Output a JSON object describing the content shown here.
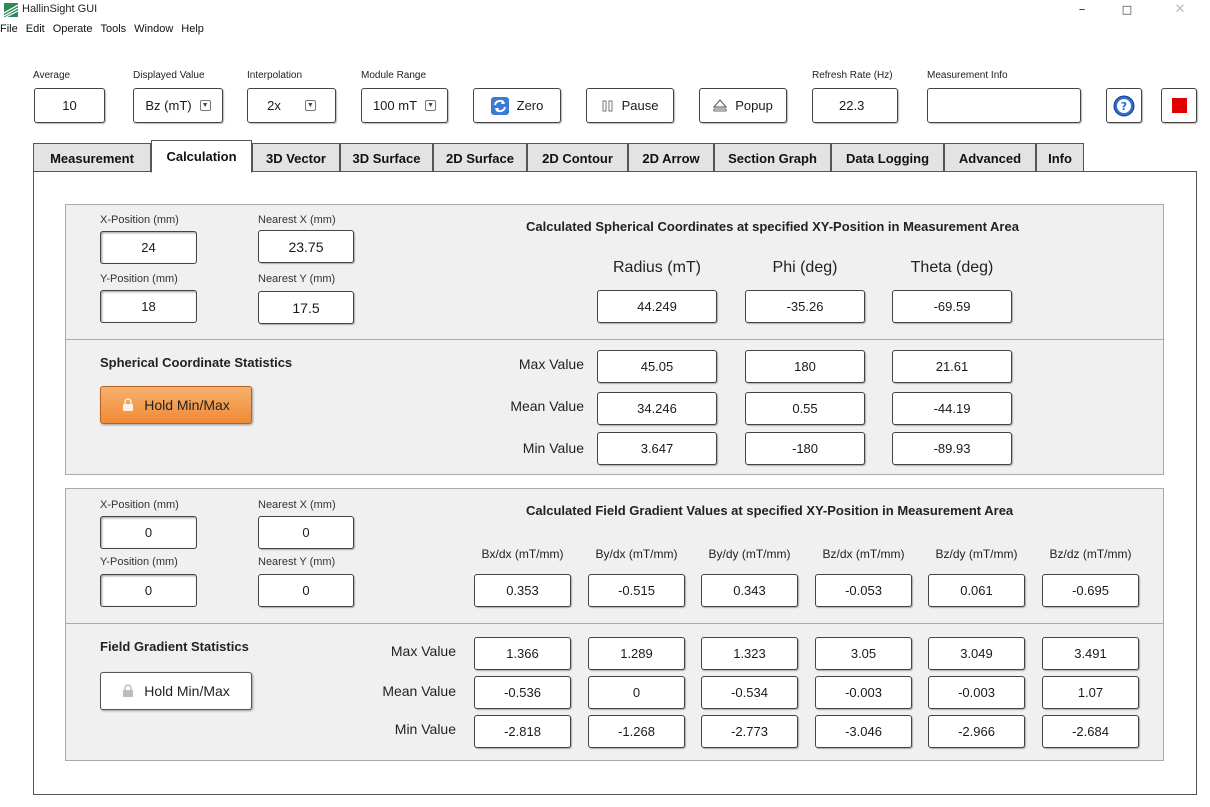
{
  "window": {
    "title": "HallinSight GUI",
    "minimize": "–",
    "maximize": "□",
    "close": "✕"
  },
  "menu": [
    "File",
    "Edit",
    "Operate",
    "Tools",
    "Window",
    "Help"
  ],
  "toolbar": {
    "average": {
      "label": "Average",
      "value": "10"
    },
    "displayed_value": {
      "label": "Displayed Value",
      "value": "Bz (mT)"
    },
    "interpolation": {
      "label": "Interpolation",
      "value": "2x"
    },
    "module_range": {
      "label": "Module Range",
      "value": "100 mT"
    },
    "zero_label": "Zero",
    "pause_label": "Pause",
    "popup_label": "Popup",
    "refresh_rate": {
      "label": "Refresh Rate (Hz)",
      "value": "22.3"
    },
    "measurement_info": {
      "label": "Measurement Info",
      "value": ""
    }
  },
  "tabs": [
    "Measurement",
    "Calculation",
    "3D Vector",
    "3D Surface",
    "2D Surface",
    "2D Contour",
    "2D Arrow",
    "Section Graph",
    "Data Logging",
    "Advanced",
    "Info"
  ],
  "spherical": {
    "x_label": "X-Position (mm)",
    "x_value": "24",
    "y_label": "Y-Position (mm)",
    "y_value": "18",
    "nx_label": "Nearest X (mm)",
    "nx_value": "23.75",
    "ny_label": "Nearest Y (mm)",
    "ny_value": "17.5",
    "heading": "Calculated Spherical Coordinates at specified XY-Position in Measurement Area",
    "columns": [
      "Radius (mT)",
      "Phi (deg)",
      "Theta (deg)"
    ],
    "current": [
      "44.249",
      "-35.26",
      "-69.59"
    ]
  },
  "spherical_stats": {
    "heading": "Spherical Coordinate Statistics",
    "hold_label": "Hold Min/Max",
    "rows": [
      {
        "label": "Max Value",
        "values": [
          "45.05",
          "180",
          "21.61"
        ]
      },
      {
        "label": "Mean Value",
        "values": [
          "34.246",
          "0.55",
          "-44.19"
        ]
      },
      {
        "label": "Min Value",
        "values": [
          "3.647",
          "-180",
          "-89.93"
        ]
      }
    ]
  },
  "gradient": {
    "x_label": "X-Position (mm)",
    "x_value": "0",
    "y_label": "Y-Position (mm)",
    "y_value": "0",
    "nx_label": "Nearest X (mm)",
    "nx_value": "0",
    "ny_label": "Nearest Y (mm)",
    "ny_value": "0",
    "heading": "Calculated Field Gradient Values at specified XY-Position in Measurement Area",
    "columns": [
      "Bx/dx (mT/mm)",
      "By/dx (mT/mm)",
      "By/dy (mT/mm)",
      "Bz/dx (mT/mm)",
      "Bz/dy (mT/mm)",
      "Bz/dz (mT/mm)"
    ],
    "current": [
      "0.353",
      "-0.515",
      "0.343",
      "-0.053",
      "0.061",
      "-0.695"
    ]
  },
  "gradient_stats": {
    "heading": "Field Gradient Statistics",
    "hold_label": "Hold Min/Max",
    "rows": [
      {
        "label": "Max Value",
        "values": [
          "1.366",
          "1.289",
          "1.323",
          "3.05",
          "3.049",
          "3.491"
        ]
      },
      {
        "label": "Mean Value",
        "values": [
          "-0.536",
          "0",
          "-0.534",
          "-0.003",
          "-0.003",
          "1.07"
        ]
      },
      {
        "label": "Min Value",
        "values": [
          "-2.818",
          "-1.268",
          "-2.773",
          "-3.046",
          "-2.966",
          "-2.684"
        ]
      }
    ]
  },
  "colors": {
    "hold_active": "#f39a4f",
    "stop": "#e00000",
    "help": "#2f6bd1"
  }
}
